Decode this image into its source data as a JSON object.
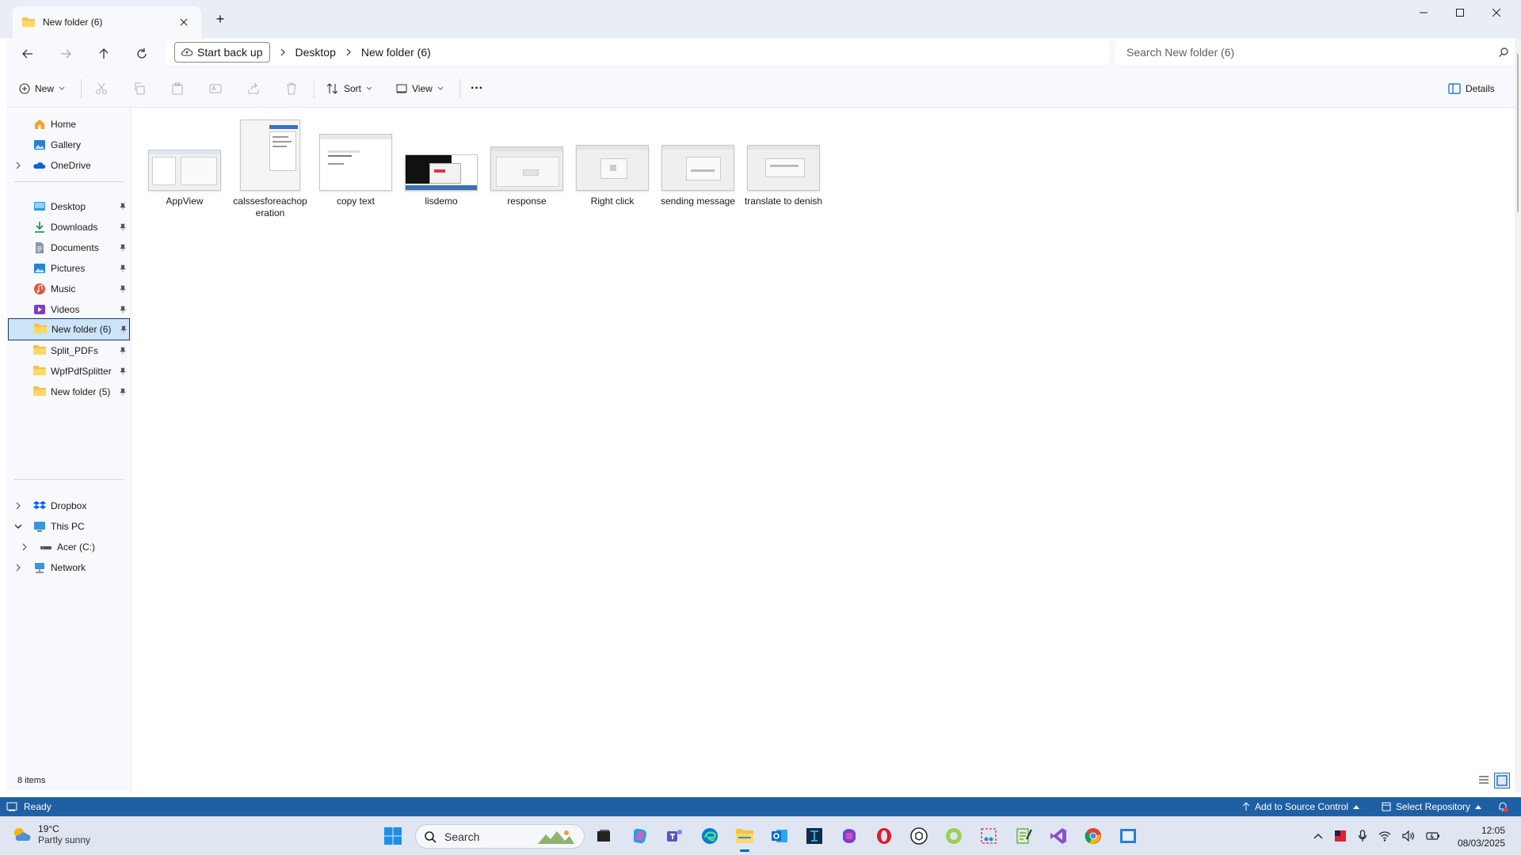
{
  "window": {
    "tab_title": "New folder (6)",
    "new_tab": "+"
  },
  "nav": {
    "start_backup_label": "Start back up",
    "breadcrumb": [
      "Desktop",
      "New folder (6)"
    ],
    "search_placeholder": "Search New folder (6)"
  },
  "commands": {
    "new_label": "New",
    "sort_label": "Sort",
    "view_label": "View",
    "more_label": "···",
    "details_label": "Details"
  },
  "sidebar": {
    "items": [
      {
        "label": "Home",
        "icon": "home-icon"
      },
      {
        "label": "Gallery",
        "icon": "gallery-icon"
      },
      {
        "label": "OneDrive",
        "icon": "onedrive-icon"
      },
      {
        "label": "Desktop",
        "icon": "desktop-icon"
      },
      {
        "label": "Downloads",
        "icon": "downloads-icon"
      },
      {
        "label": "Documents",
        "icon": "documents-icon"
      },
      {
        "label": "Pictures",
        "icon": "pictures-icon"
      },
      {
        "label": "Music",
        "icon": "music-icon"
      },
      {
        "label": "Videos",
        "icon": "videos-icon"
      },
      {
        "label": "New folder (6)",
        "icon": "folder-icon"
      },
      {
        "label": "Split_PDFs",
        "icon": "folder-icon"
      },
      {
        "label": "WpfPdfSplitter",
        "icon": "folder-icon"
      },
      {
        "label": "New folder (5)",
        "icon": "folder-icon"
      },
      {
        "label": "Dropbox",
        "icon": "dropbox-icon"
      },
      {
        "label": "This PC",
        "icon": "computer-icon"
      },
      {
        "label": "Acer (C:)",
        "icon": "drive-icon"
      },
      {
        "label": "Network",
        "icon": "network-icon"
      }
    ]
  },
  "files": [
    {
      "name": "AppView"
    },
    {
      "name": "calssesforeachoperation"
    },
    {
      "name": "copy text"
    },
    {
      "name": "lisdemo"
    },
    {
      "name": "response"
    },
    {
      "name": "Right click"
    },
    {
      "name": "sending message"
    },
    {
      "name": "translate to denish"
    }
  ],
  "status": {
    "item_count": "8 items"
  },
  "vs_status": {
    "ready": "Ready",
    "add_source": "Add to Source Control",
    "select_repo": "Select Repository"
  },
  "taskbar": {
    "weather_temp": "19°C",
    "weather_desc": "Partly sunny",
    "search_label": "Search",
    "time": "12:05",
    "date": "08/03/2025"
  },
  "colors": {
    "accent": "#0067c0",
    "folder": "#f5c242",
    "vs_bar": "#1f5fa3",
    "selection": "#cce4f7"
  }
}
